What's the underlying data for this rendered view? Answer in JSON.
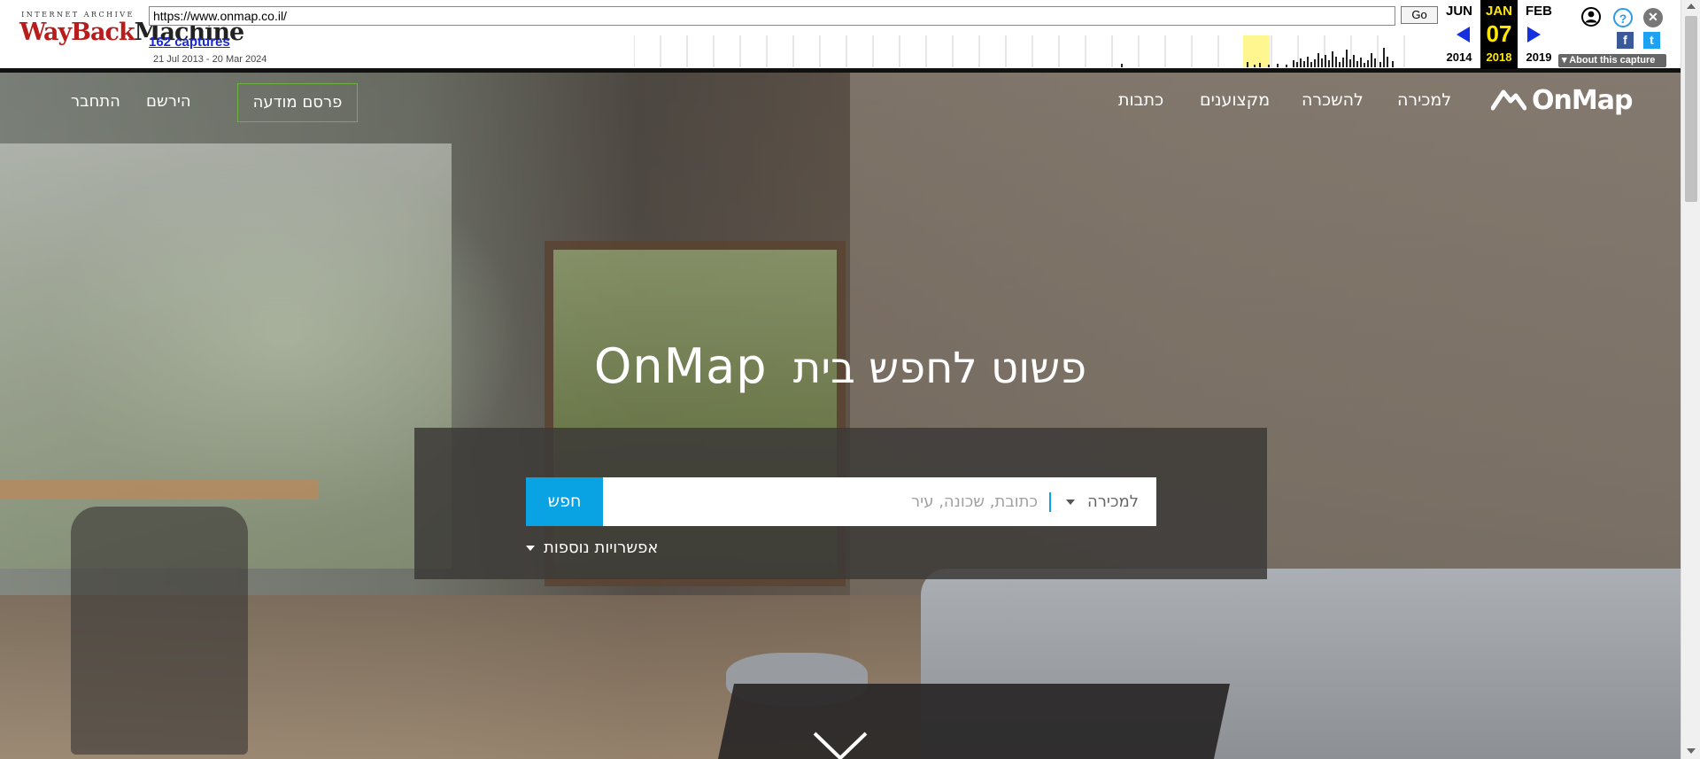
{
  "wayback": {
    "logo_top": "INTERNET ARCHIVE",
    "logo_wayback": "WayBack",
    "logo_machine": "Machine",
    "url": "https://www.onmap.co.il/",
    "go_label": "Go",
    "captures_label": "162 captures",
    "date_range": "21 Jul 2013 - 20 Mar 2024",
    "prev_month": "JUN",
    "prev_year": "2014",
    "current_month": "JAN",
    "current_day": "07",
    "current_year": "2018",
    "next_month": "FEB",
    "next_year": "2019",
    "about_label": "About this capture",
    "colors": {
      "accent": "#1530e0",
      "current_bg": "#000000",
      "current_text": "#ffe800",
      "captures_link": "#1a2bd6"
    },
    "icons": [
      "user-icon",
      "help-icon",
      "close-icon",
      "facebook-icon",
      "twitter-icon",
      "prev-arrow-icon",
      "next-arrow-icon"
    ]
  },
  "site": {
    "logo_text": "OnMap",
    "nav": {
      "sale": "למכירה",
      "rent": "להשכרה",
      "professionals": "מקצוענים",
      "articles": "כתבות"
    },
    "publish_button": "פרסם מודעה",
    "register": "הירשם",
    "login": "התחבר",
    "colors": {
      "search_button": "#09a3e4",
      "publish_border": "#6db33f"
    }
  },
  "hero": {
    "title_main": "פשוט לחפש בית",
    "title_brand": "OnMap",
    "search": {
      "deal_type": "למכירה",
      "placeholder": "כתובת, שכונה, עיר",
      "button": "חפש"
    },
    "more_options": "אפשרויות נוספות"
  }
}
